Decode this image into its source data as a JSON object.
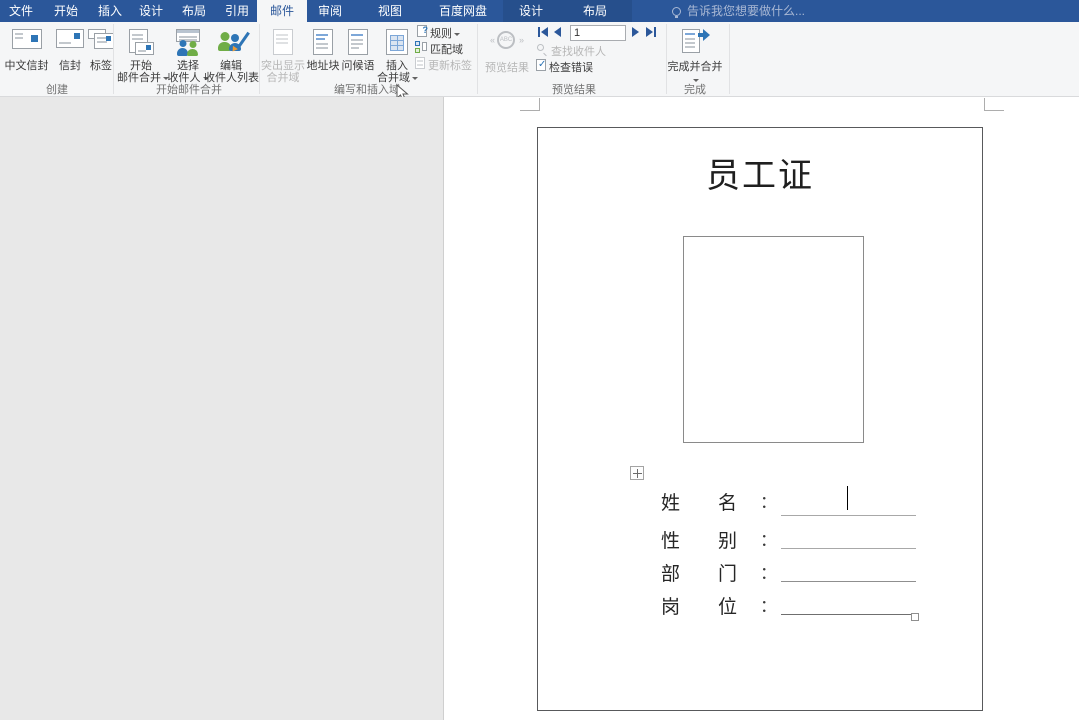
{
  "titlebar": {
    "tabs": [
      {
        "label": "文件"
      },
      {
        "label": "开始"
      },
      {
        "label": "插入"
      },
      {
        "label": "设计"
      },
      {
        "label": "布局"
      },
      {
        "label": "引用"
      },
      {
        "label": "邮件",
        "active": true
      },
      {
        "label": "审阅"
      },
      {
        "label": "视图"
      },
      {
        "label": "百度网盘"
      },
      {
        "label": "设计",
        "contextual": true
      },
      {
        "label": "布局",
        "contextual": true
      }
    ],
    "tell_me": "告诉我您想要做什么...",
    "bar_color": "#2b579a"
  },
  "ribbon": {
    "create": {
      "group_label": "创建",
      "chinese_envelope": "中文信封",
      "envelope": "信封",
      "labels": "标签"
    },
    "start_merge": {
      "group_label": "开始邮件合并",
      "start_line1": "开始",
      "start_line2": "邮件合并",
      "select_line1": "选择",
      "select_line2": "收件人",
      "edit_line1": "编辑",
      "edit_line2": "收件人列表"
    },
    "write_insert": {
      "group_label": "编写和插入域",
      "highlight_line1": "突出显示",
      "highlight_line2": "合并域",
      "address_block": "地址块",
      "greeting_line": "问候语",
      "insert_line1": "插入",
      "insert_line2": "合并域",
      "rules": "规则",
      "match_fields": "匹配域",
      "update_labels": "更新标签"
    },
    "preview": {
      "group_label": "预览结果",
      "preview_results": "预览结果",
      "record_value": "1",
      "find_recipient": "查找收件人",
      "check_errors": "检查错误"
    },
    "finish": {
      "group_label": "完成",
      "finish_merge": "完成并合并"
    }
  },
  "document": {
    "title": "员工证",
    "colon": "：",
    "fields": [
      {
        "c1": "姓",
        "c2": "名"
      },
      {
        "c1": "性",
        "c2": "别"
      },
      {
        "c1": "部",
        "c2": "门"
      },
      {
        "c1": "岗",
        "c2": "位"
      }
    ]
  },
  "colors": {
    "accent_blue": "#2b579a",
    "icon_blue": "#2e75b6",
    "icon_green": "#70ad47",
    "workspace_gray": "#e8e8e8",
    "disabled_text": "#b6b6b6"
  }
}
